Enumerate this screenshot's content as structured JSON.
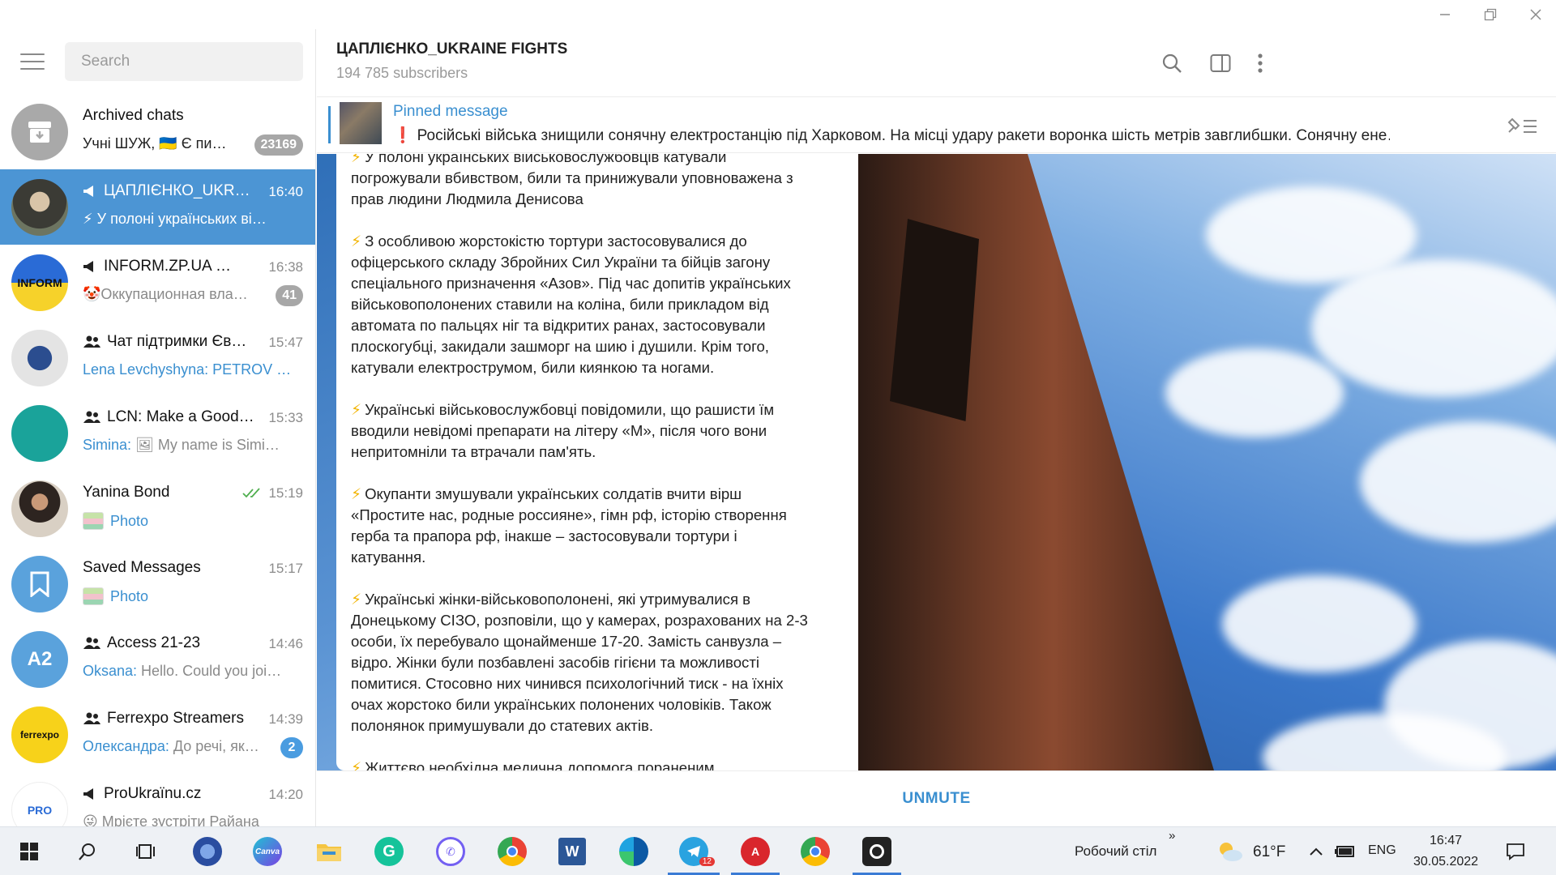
{
  "window": {
    "controls": [
      "minimize",
      "restore",
      "close"
    ]
  },
  "search": {
    "placeholder": "Search"
  },
  "chats": [
    {
      "name": "Archived chats",
      "preview": "Учні ШУЖ, 🇺🇦 Є пи…",
      "badge": "23169",
      "icon": "archive-icon"
    },
    {
      "name": "ЦАПЛІЄНКО_UKR…",
      "time": "16:40",
      "preview": "⚡ У полоні українських ві…",
      "type": "channel",
      "active": true
    },
    {
      "name": "INFORM.ZP.UA …",
      "time": "16:38",
      "preview": "🤡Оккупационная вла…",
      "badge": "41",
      "type": "channel"
    },
    {
      "name": "Чат підтримки Єв…",
      "time": "15:47",
      "sender": "Lena Levchyshyna:",
      "preview": "PETROV …",
      "type": "group"
    },
    {
      "name": "LCN: Make a Good…",
      "time": "15:33",
      "sender": "Simina:",
      "preview": "🖼 My name is Simi…",
      "type": "group"
    },
    {
      "name": "Yanina Bond",
      "time": "15:19",
      "preview": "Photo",
      "read": true
    },
    {
      "name": "Saved Messages",
      "time": "15:17",
      "preview": "Photo"
    },
    {
      "name": "Access 21-23",
      "time": "14:46",
      "sender": "Oksana:",
      "preview": "Hello. Could you joi…",
      "type": "group",
      "initials": "A2"
    },
    {
      "name": "Ferrexpo Streamers",
      "time": "14:39",
      "sender": "Олександра:",
      "preview": "До речі, як…",
      "badge": "2",
      "type": "group"
    },
    {
      "name": "ProUkraїnu.cz",
      "time": "14:20",
      "preview": "😜 Мрієте зустріти Райана",
      "type": "channel"
    }
  ],
  "header": {
    "title": "ЦАПЛІЄНКО_UKRAINE FIGHTS",
    "subscribers": "194 785 subscribers"
  },
  "pinned": {
    "title": "Pinned message",
    "text": "Російські війська знищили сонячну електростанцію під Харковом.   На місці удару ракети воронка шість метрів завглибшки.  Сонячну ене…"
  },
  "message": {
    "paragraphs": [
      "У полоні українських військовослужбовців катували\nпогрожували вбивством, били та принижували  уповноважена з\nправ людини Людмила Денисова",
      "З особливою жорстокістю тортури застосовувалися до\nофіцерського складу Збройних Сил України та бійців загону\nспеціального призначення «Азов». Під час допитів українських\nвійськовополонених ставили на коліна, били прикладом від\nавтомата по пальцях ніг та відкритих ранах, застосовували\nплоскогубці, закидали зашморг на шию і душили. Крім того,\nкатували електрострумом, били киянкою та ногами.",
      "Українські військовослужбовці повідомили, що рашисти їм\nвводили невідомі препарати на літеру «М», після чого вони\nнепритомніли та втрачали пам'ять.",
      "Окупанти змушували українських солдатів вчити вірш\n«Простите нас, родные россияне», гімн рф, історію створення\nгерба та прапора рф, інакше – застосовували тортури і\nкатування.",
      "Українські жінки-військовополонені, які утримувалися в\nДонецькому СІЗО, розповіли, що у камерах, розрахованих на 2-3\nособи, їх перебувало щонайменше 17-20. Замість санвузла –\nвідро. Жінки були позбавлені засобів гігієни та можливості\nпомитися. Стосовно них чинився психологічний тиск - на їхніх\nочах жорстоко били українських полонених чоловіків.  Також\nполонянок примушували до статевих актів.",
      "Життєво необхідна медична допомога пораненим"
    ],
    "bolt": "⚡"
  },
  "bottom": {
    "unmute": "UNMUTE"
  },
  "taskbar": {
    "desktop_label": "Робочий стіл",
    "weather": "61°F",
    "lang": "ENG",
    "time": "16:47",
    "date": "30.05.2022",
    "telegram_badge": "12",
    "chevron": "»"
  },
  "colors": {
    "accent": "#3a8fd0",
    "active_chat": "#4c95d4"
  }
}
